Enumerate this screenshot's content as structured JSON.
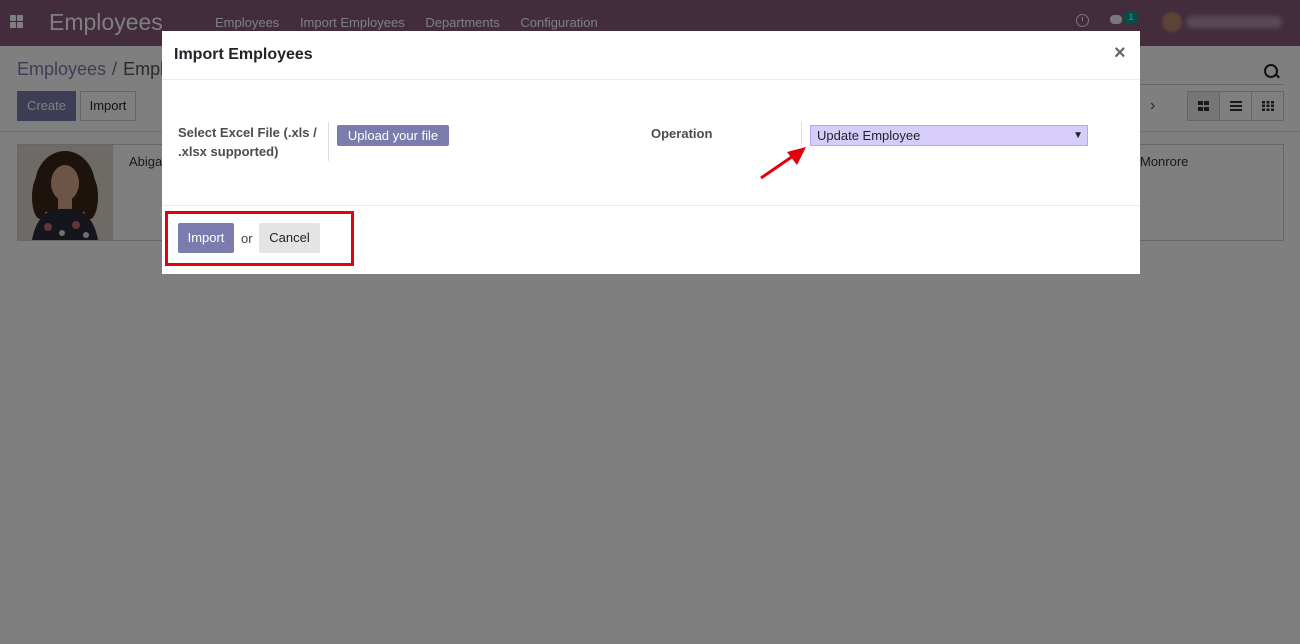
{
  "navbar": {
    "app_title": "Employees",
    "menu": [
      "Employees",
      "Import Employees",
      "Departments",
      "Configuration"
    ],
    "chat_badge": "1",
    "bg_color": "#875a7b"
  },
  "control_panel": {
    "breadcrumb_first": "Employees",
    "breadcrumb_sep": "/",
    "breadcrumb_second": "Empl",
    "create_label": "Create",
    "import_label": "Import",
    "pager_next": "›"
  },
  "kanban": {
    "card_name": "Abiga",
    "card_right_name": "Monrore"
  },
  "modal": {
    "title": "Import Employees",
    "close": "×",
    "file_label": "Select Excel File (.xls / .xlsx supported)",
    "upload_label": "Upload your file",
    "operation_label": "Operation",
    "operation_value": "Update Employee",
    "import_label": "Import",
    "or_text": "or",
    "cancel_label": "Cancel"
  },
  "colors": {
    "accent": "#7c7bad",
    "annotation": "#e3000f",
    "select_bg": "#d7cdfa"
  },
  "icons": [
    "apps-icon",
    "clock-icon",
    "chat-icon",
    "search-icon",
    "chevron-right-icon",
    "kanban-view-icon",
    "list-view-icon",
    "grid-view-icon",
    "close-icon",
    "caret-down-icon"
  ]
}
